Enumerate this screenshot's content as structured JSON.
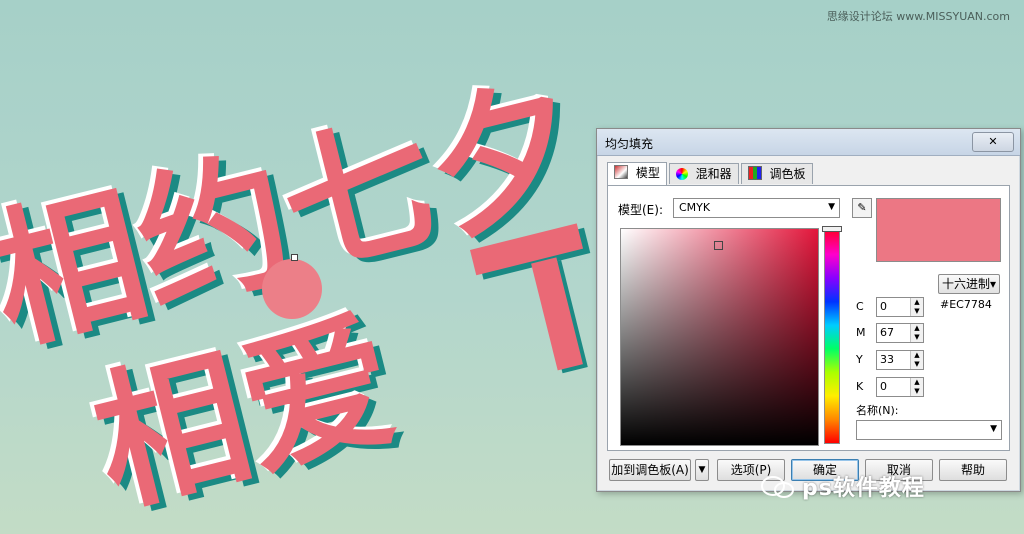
{
  "watermark_top": "思缘设计论坛 www.MISSYUAN.com",
  "artwork": {
    "line1": "相约七夕",
    "line2": "相爱",
    "text_color": "#ea6976",
    "shadow_color": "#1b8a84",
    "highlight_color": "#ffffff",
    "dot_color": "#ec7f88"
  },
  "dialog": {
    "title": "均匀填充",
    "close_label": "✕",
    "tabs": [
      {
        "label": "模型",
        "icon": "color-model-icon",
        "active": true
      },
      {
        "label": "混和器",
        "icon": "color-wheel-icon",
        "active": false
      },
      {
        "label": "调色板",
        "icon": "palette-grid-icon",
        "active": false
      }
    ],
    "model_label": "模型(E):",
    "model_value": "CMYK",
    "hex_button": "十六进制▾",
    "hex_value": "#EC7784",
    "preview_color": "#ec7784",
    "cmyk": [
      {
        "label": "C",
        "value": "0"
      },
      {
        "label": "M",
        "value": "67"
      },
      {
        "label": "Y",
        "value": "33"
      },
      {
        "label": "K",
        "value": "0"
      }
    ],
    "name_label": "名称(N):",
    "name_value": "",
    "buttons": {
      "add_palette": "加到调色板(A)",
      "options": "选项(P)",
      "ok": "确定",
      "cancel": "取消",
      "help": "帮助"
    }
  },
  "watermark_bottom": "ps软件教程"
}
